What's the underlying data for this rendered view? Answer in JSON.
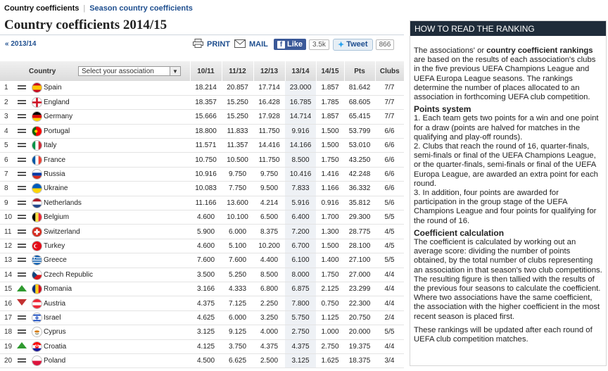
{
  "tabs": {
    "active": "Country coefficients",
    "link": "Season country coefficients"
  },
  "title": "Country coefficients 2014/15",
  "prev_link": "« 2013/14",
  "toolbar": {
    "print": "PRINT",
    "mail": "MAIL",
    "like": "Like",
    "like_count": "3.5k",
    "tweet": "Tweet",
    "tweet_count": "866"
  },
  "table": {
    "headers": {
      "country": "Country",
      "select": "Select your association",
      "c1": "10/11",
      "c2": "11/12",
      "c3": "12/13",
      "c4": "13/14",
      "c5": "14/15",
      "pts": "Pts",
      "clubs": "Clubs"
    },
    "rows": [
      {
        "rank": "1",
        "trend": "eq",
        "name": "Spain",
        "flag": "spain",
        "s": [
          "18.214",
          "20.857",
          "17.714",
          "23.000",
          "1.857"
        ],
        "pts": "81.642",
        "clubs": "7/7"
      },
      {
        "rank": "2",
        "trend": "eq",
        "name": "England",
        "flag": "england",
        "s": [
          "18.357",
          "15.250",
          "16.428",
          "16.785",
          "1.785"
        ],
        "pts": "68.605",
        "clubs": "7/7"
      },
      {
        "rank": "3",
        "trend": "eq",
        "name": "Germany",
        "flag": "germany",
        "s": [
          "15.666",
          "15.250",
          "17.928",
          "14.714",
          "1.857"
        ],
        "pts": "65.415",
        "clubs": "7/7"
      },
      {
        "rank": "4",
        "trend": "eq",
        "name": "Portugal",
        "flag": "portugal",
        "s": [
          "18.800",
          "11.833",
          "11.750",
          "9.916",
          "1.500"
        ],
        "pts": "53.799",
        "clubs": "6/6"
      },
      {
        "rank": "5",
        "trend": "eq",
        "name": "Italy",
        "flag": "italy",
        "s": [
          "11.571",
          "11.357",
          "14.416",
          "14.166",
          "1.500"
        ],
        "pts": "53.010",
        "clubs": "6/6"
      },
      {
        "rank": "6",
        "trend": "eq",
        "name": "France",
        "flag": "france",
        "s": [
          "10.750",
          "10.500",
          "11.750",
          "8.500",
          "1.750"
        ],
        "pts": "43.250",
        "clubs": "6/6"
      },
      {
        "rank": "7",
        "trend": "eq",
        "name": "Russia",
        "flag": "russia",
        "s": [
          "10.916",
          "9.750",
          "9.750",
          "10.416",
          "1.416"
        ],
        "pts": "42.248",
        "clubs": "6/6"
      },
      {
        "rank": "8",
        "trend": "eq",
        "name": "Ukraine",
        "flag": "ukraine",
        "s": [
          "10.083",
          "7.750",
          "9.500",
          "7.833",
          "1.166"
        ],
        "pts": "36.332",
        "clubs": "6/6"
      },
      {
        "rank": "9",
        "trend": "eq",
        "name": "Netherlands",
        "flag": "netherlands",
        "s": [
          "11.166",
          "13.600",
          "4.214",
          "5.916",
          "0.916"
        ],
        "pts": "35.812",
        "clubs": "5/6"
      },
      {
        "rank": "10",
        "trend": "eq",
        "name": "Belgium",
        "flag": "belgium",
        "s": [
          "4.600",
          "10.100",
          "6.500",
          "6.400",
          "1.700"
        ],
        "pts": "29.300",
        "clubs": "5/5"
      },
      {
        "rank": "11",
        "trend": "eq",
        "name": "Switzerland",
        "flag": "switzerland",
        "s": [
          "5.900",
          "6.000",
          "8.375",
          "7.200",
          "1.300"
        ],
        "pts": "28.775",
        "clubs": "4/5"
      },
      {
        "rank": "12",
        "trend": "eq",
        "name": "Turkey",
        "flag": "turkey",
        "s": [
          "4.600",
          "5.100",
          "10.200",
          "6.700",
          "1.500"
        ],
        "pts": "28.100",
        "clubs": "4/5"
      },
      {
        "rank": "13",
        "trend": "eq",
        "name": "Greece",
        "flag": "greece",
        "s": [
          "7.600",
          "7.600",
          "4.400",
          "6.100",
          "1.400"
        ],
        "pts": "27.100",
        "clubs": "5/5"
      },
      {
        "rank": "14",
        "trend": "eq",
        "name": "Czech Republic",
        "flag": "czech",
        "s": [
          "3.500",
          "5.250",
          "8.500",
          "8.000",
          "1.750"
        ],
        "pts": "27.000",
        "clubs": "4/4"
      },
      {
        "rank": "15",
        "trend": "up",
        "name": "Romania",
        "flag": "romania",
        "s": [
          "3.166",
          "4.333",
          "6.800",
          "6.875",
          "2.125"
        ],
        "pts": "23.299",
        "clubs": "4/4"
      },
      {
        "rank": "16",
        "trend": "down",
        "name": "Austria",
        "flag": "austria",
        "s": [
          "4.375",
          "7.125",
          "2.250",
          "7.800",
          "0.750"
        ],
        "pts": "22.300",
        "clubs": "4/4"
      },
      {
        "rank": "17",
        "trend": "eq",
        "name": "Israel",
        "flag": "israel",
        "s": [
          "4.625",
          "6.000",
          "3.250",
          "5.750",
          "1.125"
        ],
        "pts": "20.750",
        "clubs": "2/4"
      },
      {
        "rank": "18",
        "trend": "eq",
        "name": "Cyprus",
        "flag": "cyprus",
        "s": [
          "3.125",
          "9.125",
          "4.000",
          "2.750",
          "1.000"
        ],
        "pts": "20.000",
        "clubs": "5/5"
      },
      {
        "rank": "19",
        "trend": "up",
        "name": "Croatia",
        "flag": "croatia",
        "s": [
          "4.125",
          "3.750",
          "4.375",
          "4.375",
          "2.750"
        ],
        "pts": "19.375",
        "clubs": "4/4"
      },
      {
        "rank": "20",
        "trend": "eq",
        "name": "Poland",
        "flag": "poland",
        "s": [
          "4.500",
          "6.625",
          "2.500",
          "3.125",
          "1.625"
        ],
        "pts": "18.375",
        "clubs": "3/4"
      }
    ]
  },
  "panel": {
    "title": "HOW TO READ THE RANKING",
    "intro_a": "The associations' or ",
    "intro_b": "country coefficient rankings",
    "intro_c": " are based on the results of each association's clubs in the five previous UEFA Champions League and UEFA Europa League seasons. The rankings determine the number of places allocated to an association in forthcoming UEFA club competition.",
    "h_points": "Points system",
    "p1": "1. Each team gets two points for a win and one point for a draw (points are halved for matches in the qualifying and play-off rounds).",
    "p2": "2. Clubs that reach the round of 16, quarter-finals, semi-finals or final of the UEFA Champions League, or the quarter-finals, semi-finals or final of the UEFA Europa League, are awarded an extra point for each round.",
    "p3": "3. In addition, four points are awarded for participation in the group stage of the UEFA Champions League and four points for qualifying for the round of 16.",
    "h_calc": "Coefficient calculation",
    "calc": "The coefficient is calculated by working out an average score: dividing the number of points obtained, by the total number of clubs representing an association in that season's two club competitions. The resulting figure is then tallied with the results of the previous four seasons to calculate the coefficient. Where two associations have the same coefficient, the association with the higher coefficient in the most recent season is placed first.",
    "footer": "These rankings will be updated after each round of UEFA club competition matches."
  }
}
